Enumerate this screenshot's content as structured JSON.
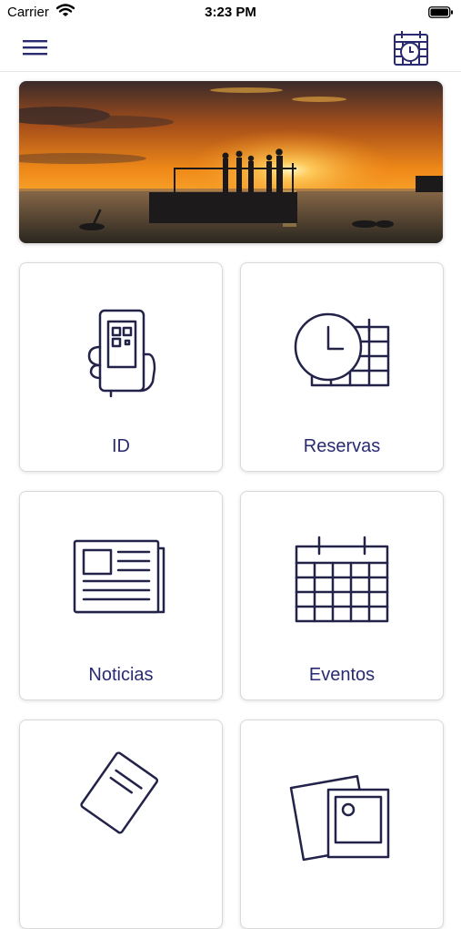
{
  "status_bar": {
    "carrier": "Carrier",
    "time": "3:23 PM"
  },
  "nav": {
    "menu_icon": "hamburger-menu-icon",
    "schedule_icon": "calendar-clock-icon"
  },
  "banner": {
    "image": "sunset-pier-photo"
  },
  "tiles": [
    {
      "label": "ID",
      "icon": "phone-qr-code-icon"
    },
    {
      "label": "Reservas",
      "icon": "clock-calendar-icon"
    },
    {
      "label": "Noticias",
      "icon": "newspaper-icon"
    },
    {
      "label": "Eventos",
      "icon": "calendar-icon"
    },
    {
      "label": "",
      "icon": "ticket-icon"
    },
    {
      "label": "",
      "icon": "photo-gallery-icon"
    }
  ],
  "colors": {
    "accent": "#2a2a72",
    "icon_stroke": "#23234a",
    "background": "#ffffff"
  }
}
